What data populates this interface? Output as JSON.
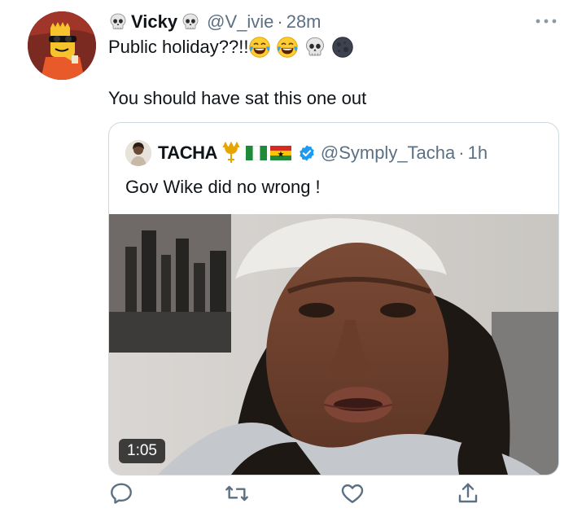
{
  "tweet": {
    "author_name": "Vicky",
    "author_handle": "@V_ivie",
    "separator": "·",
    "timestamp": "28m",
    "text_line1": "Public holiday??!!",
    "text_line2": "You should have sat this one out",
    "emoji_after_text": [
      "joy-emoji",
      "joy-emoji",
      "skull-emoji",
      "new-moon-emoji"
    ]
  },
  "quoted": {
    "author_name": "TACHA",
    "name_emoji": [
      "trident-emoji",
      "nigeria-flag-emoji",
      "ghana-flag-emoji"
    ],
    "verified": true,
    "author_handle": "@Symply_Tacha",
    "separator": "·",
    "timestamp": "1h",
    "text": "Gov Wike did no wrong !",
    "video_duration": "1:05"
  },
  "actions": [
    "reply-icon",
    "retweet-icon",
    "like-icon",
    "share-icon"
  ],
  "colors": {
    "text": "#0f1419",
    "secondary": "#5b7083",
    "border": "#cfd9de",
    "verified": "#1d9bf0"
  }
}
